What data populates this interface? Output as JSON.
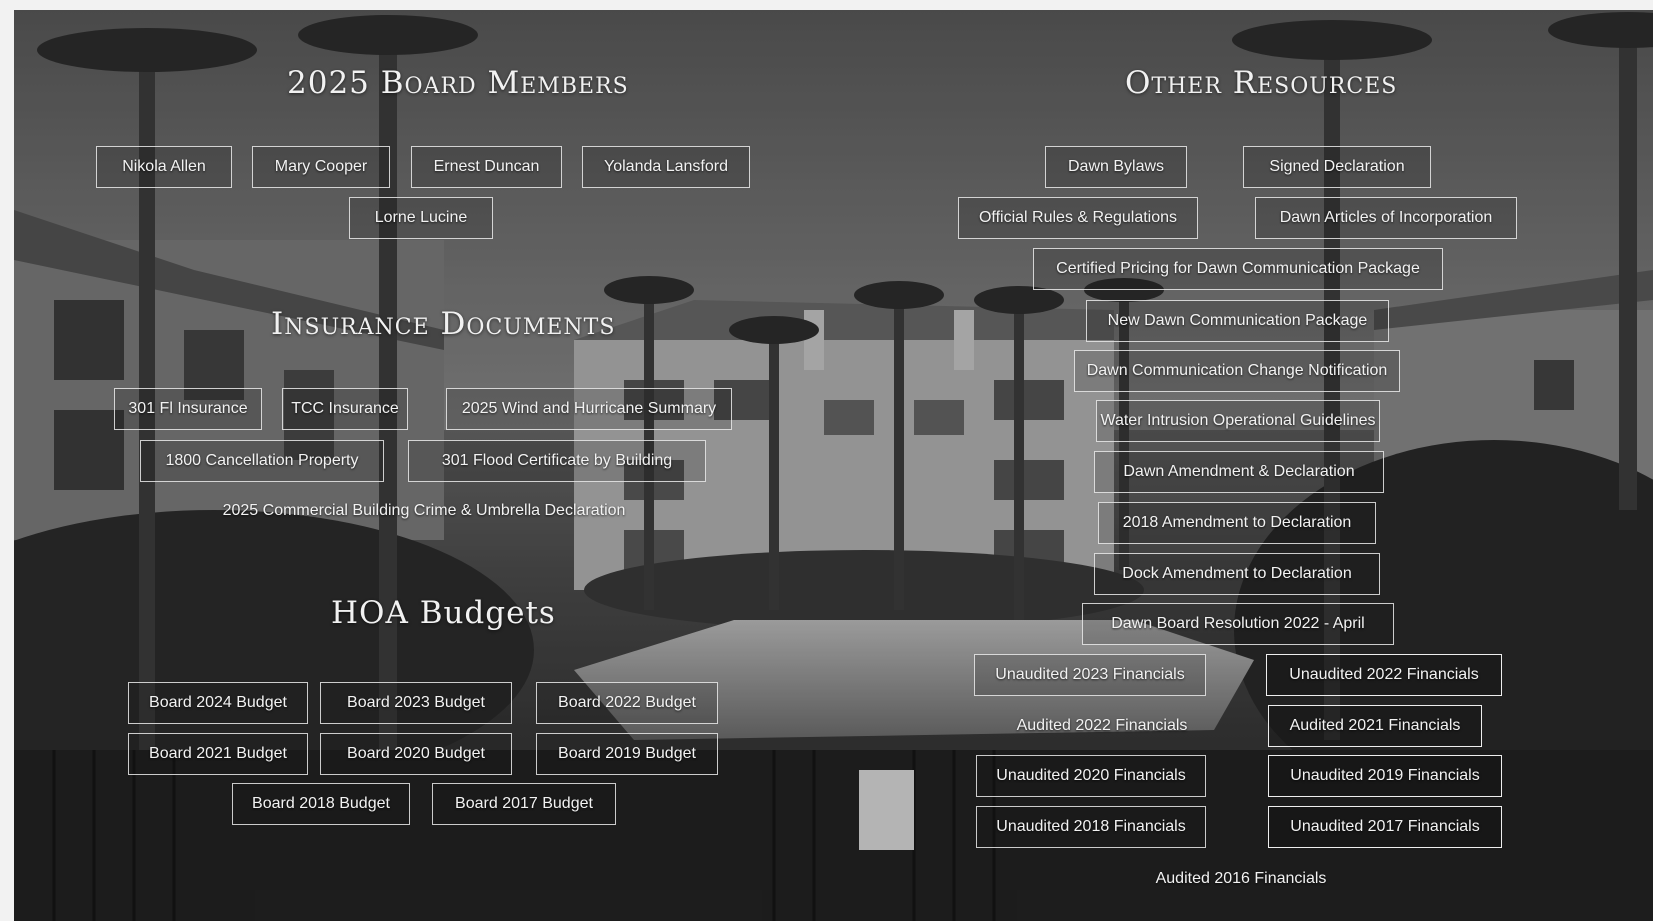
{
  "board": {
    "title": "2025 Board Members",
    "members": [
      "Nikola Allen",
      "Mary Cooper",
      "Ernest Duncan",
      "Yolanda Lansford",
      "Lorne Lucine"
    ]
  },
  "insurance": {
    "title": "Insurance Documents",
    "items": [
      "301 Fl Insurance",
      "TCC Insurance",
      "2025 Wind and Hurricane Summary",
      "1800 Cancellation Property",
      "301 Flood Certificate by Building",
      "2025 Commercial Building Crime & Umbrella Declaration"
    ]
  },
  "budgets": {
    "title": "HOA Budgets",
    "items": [
      "Board 2024 Budget",
      "Board 2023 Budget",
      "Board 2022 Budget",
      "Board 2021 Budget",
      "Board 2020 Budget",
      "Board 2019 Budget",
      "Board 2018 Budget",
      "Board 2017 Budget"
    ]
  },
  "resources": {
    "title": "Other Resources",
    "items": [
      "Dawn Bylaws",
      "Signed Declaration",
      "Official Rules & Regulations",
      "Dawn Articles of Incorporation",
      "Certified Pricing for Dawn Communication Package",
      "New Dawn Communication Package",
      "Dawn Communication Change Notification",
      "Water Intrusion Operational Guidelines",
      "Dawn Amendment & Declaration",
      "2018 Amendment to Declaration",
      "Dock Amendment to Declaration",
      "Dawn Board Resolution 2022 - April"
    ],
    "financials": [
      "Unaudited 2023 Financials",
      "Unaudited 2022 Financials",
      "Audited 2022 Financials",
      "Audited 2021 Financials",
      "Unaudited 2020 Financials",
      "Unaudited 2019 Financials",
      "Unaudited 2018 Financials",
      "Unaudited 2017 Financials",
      "Audited 2016 Financials"
    ]
  }
}
